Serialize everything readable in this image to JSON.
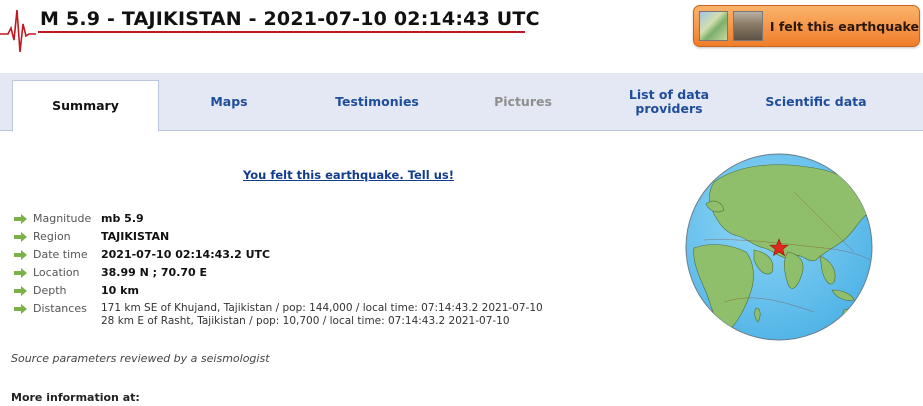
{
  "header": {
    "title": "M 5.9 - TAJIKISTAN - 2021-07-10 02:14:43 UTC",
    "felt_button_label": "I felt this earthquake"
  },
  "tabs": [
    {
      "label": "Summary",
      "state": "active"
    },
    {
      "label": "Maps",
      "state": "normal"
    },
    {
      "label": "Testimonies",
      "state": "normal"
    },
    {
      "label": "Pictures",
      "state": "disabled"
    },
    {
      "label": "List of data providers",
      "line1": "List of data",
      "line2": "providers",
      "state": "normal"
    },
    {
      "label": "Scientific data",
      "state": "normal"
    }
  ],
  "felt_link": "You felt this earthquake. Tell us!",
  "details": {
    "magnitude": {
      "label": "Magnitude",
      "value": "mb 5.9"
    },
    "region": {
      "label": "Region",
      "value": "TAJIKISTAN"
    },
    "datetime": {
      "label": "Date time",
      "value": "2021-07-10 02:14:43.2 UTC"
    },
    "location": {
      "label": "Location",
      "value": "38.99 N ; 70.70 E"
    },
    "depth": {
      "label": "Depth",
      "value": "10 km"
    },
    "distances": {
      "label": "Distances",
      "lines": [
        "171 km SE of Khujand, Tajikistan / pop: 144,000 / local time: 07:14:43.2 2021-07-10",
        "28 km E of Rasht, Tajikistan / pop: 10,700 / local time: 07:14:43.2 2021-07-10"
      ]
    }
  },
  "source_note": "Source parameters reviewed by a seismologist",
  "more_info": "More information at:",
  "icons": {
    "seismogram": "seismogram-icon",
    "bullet": "green-arrow-icon",
    "epicenter": "red-star-icon"
  },
  "colors": {
    "accent_red": "#c0181f",
    "button_orange": "#ef7d2a",
    "tab_link_blue": "#1f4d9a",
    "tab_bar": "#e3e8f4",
    "bullet_green": "#7ab248",
    "ocean": "#6ec6ee",
    "land": "#8fbf6a"
  }
}
